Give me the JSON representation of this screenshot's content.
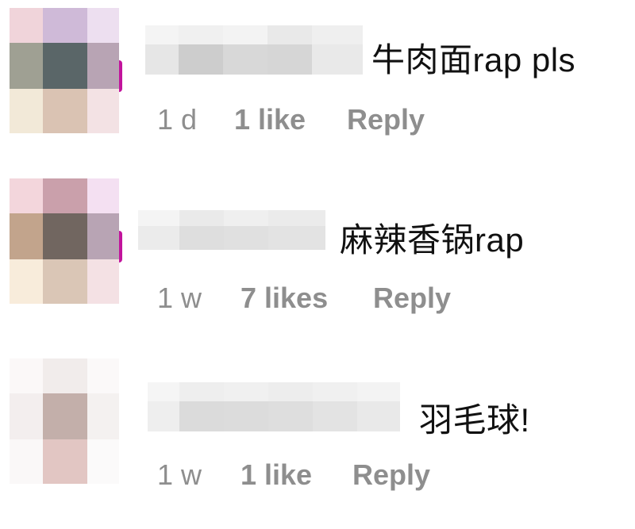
{
  "comments": [
    {
      "text": "牛肉面rap pls",
      "time": "1 d",
      "likes": "1 like",
      "reply_label": "Reply"
    },
    {
      "text": "麻辣香锅rap",
      "time": "1 w",
      "likes": "7 likes",
      "reply_label": "Reply"
    },
    {
      "text": "羽毛球!",
      "time": "1 w",
      "likes": "1 like",
      "reply_label": "Reply"
    }
  ],
  "colors": {
    "meta_text": "#8e8e8e",
    "comment_text": "#111111",
    "story_ring": "#c2139c"
  }
}
